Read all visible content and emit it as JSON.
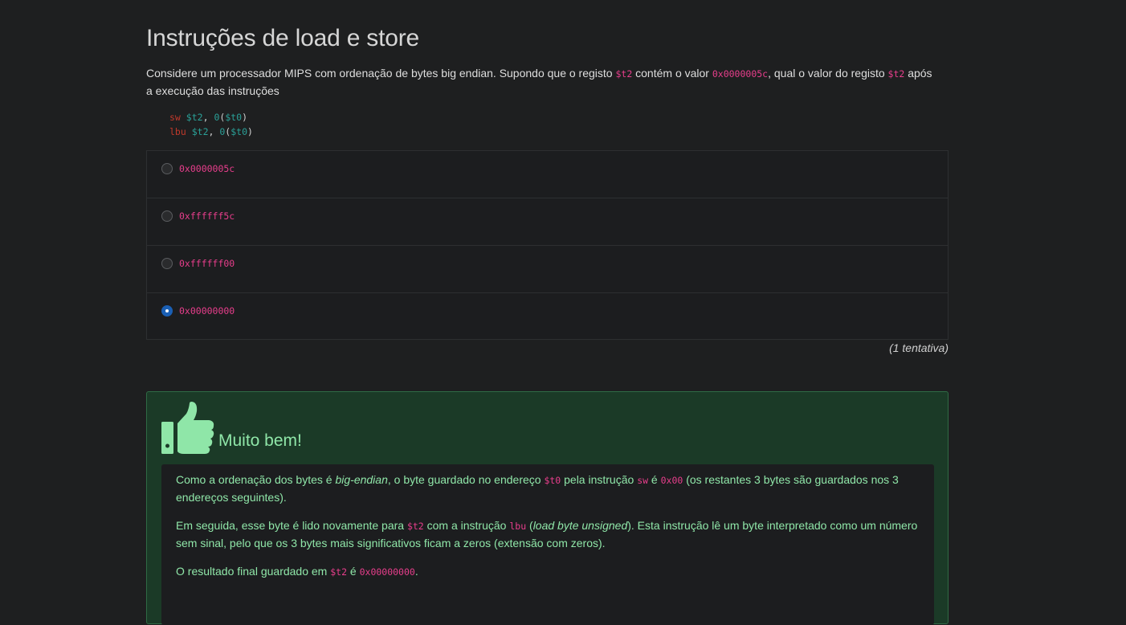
{
  "title": "Instruções de load e store",
  "prompt": {
    "part1": "Considere um processador MIPS com ordenação de bytes big endian. Supondo que o registo ",
    "reg1": "$t2",
    "part2": " contém o valor ",
    "val": "0x0000005c",
    "part3": ", qual o valor do registo ",
    "reg2": "$t2",
    "part4": " após a execução das instruções"
  },
  "code": [
    {
      "op": "sw",
      "reg": "$t2",
      "off": "0",
      "base": "$t0"
    },
    {
      "op": "lbu",
      "reg": "$t2",
      "off": "0",
      "base": "$t0"
    }
  ],
  "options": [
    {
      "label": "0x0000005c",
      "checked": false
    },
    {
      "label": "0xffffff5c",
      "checked": false
    },
    {
      "label": "0xffffff00",
      "checked": false
    },
    {
      "label": "0x00000000",
      "checked": true
    }
  ],
  "attempts": "(1 tentativa)",
  "feedback": {
    "title": "Muito bem!",
    "p1": {
      "a": "Como a ordenação dos bytes é ",
      "em": "big-endian",
      "b": ", o byte guardado no endereço ",
      "c1": "$t0",
      "d": " pela instrução ",
      "c2": "sw",
      "e": " é ",
      "c3": "0x00",
      "f": " (os restantes 3 bytes são guardados nos 3 endereços seguintes)."
    },
    "p2": {
      "a": "Em seguida, esse byte é lido novamente para ",
      "c1": "$t2",
      "b": " com a instrução ",
      "c2": "lbu",
      "c": " (",
      "em": "load byte unsigned",
      "d": "). Esta instrução lê um byte interpretado como um número sem sinal, pelo que os 3 bytes mais significativos ficam a zeros (extensão com zeros)."
    },
    "p3": {
      "a": "O resultado final guardado em ",
      "c1": "$t2",
      "b": " é ",
      "c2": "0x00000000",
      "c": "."
    }
  },
  "colors": {
    "success_text": "#8fe6a8",
    "code_pink": "#e83e8c",
    "radio_checked": "#1a5fb4"
  },
  "icons": {
    "thumb": "thumbs-up-icon"
  }
}
